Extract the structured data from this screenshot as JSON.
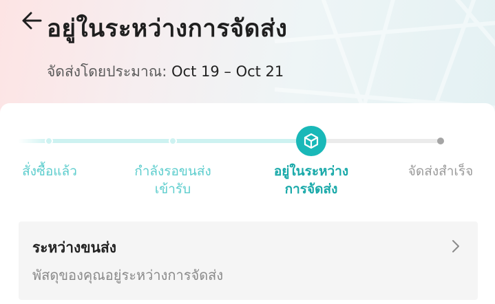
{
  "header": {
    "title": "อยู่ในระหว่างการจัดส่ง",
    "eta_label": "จัดส่งโดยประมาณ:",
    "eta_dates": "Oct 19 – Oct 21",
    "back_icon": "arrow-left-icon"
  },
  "progress": {
    "accent_color": "#19b8b8",
    "done_color": "#cdf2f1",
    "steps": [
      {
        "label": "สั่งซื้อแล้ว",
        "state": "done"
      },
      {
        "label": "กำลังรอขนส่ง\nเข้ารับ",
        "label_line1": "กำลังรอขนส่ง",
        "label_line2": "เข้ารับ",
        "state": "done"
      },
      {
        "label": "อยู่ในระหว่าง\nการจัดส่ง",
        "label_line1": "อยู่ในระหว่าง",
        "label_line2": "การจัดส่ง",
        "state": "current",
        "icon": "package-box-icon"
      },
      {
        "label": "จัดส่งสำเร็จ",
        "state": "todo"
      }
    ]
  },
  "status_card": {
    "title": "ระหว่างขนส่ง",
    "description": "พัสดุของคุณอยู่ระหว่างการจัดส่ง",
    "chevron_icon": "chevron-right-icon"
  }
}
